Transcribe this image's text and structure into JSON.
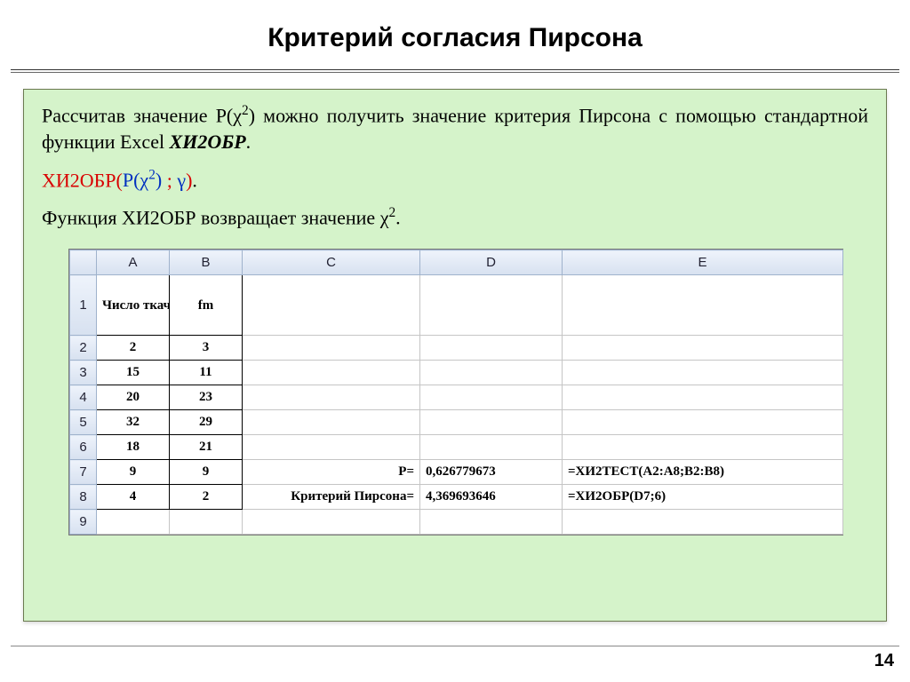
{
  "title": "Критерий согласия Пирсона",
  "para1_a": "Рассчитав значение P(χ",
  "para1_b": ") можно получить значение критерия Пирсона с помощью стандартной функции Excel ",
  "para1_func": "ХИ2ОБР",
  "para1_c": ".",
  "formula": {
    "fn": "ХИ2ОБР(",
    "arg1a": "P(χ",
    "arg1b": ")",
    "sep": " ; ",
    "arg2": "γ",
    "close": ")",
    "dot": "."
  },
  "para2_a": "Функция ХИ2ОБР возвращает значение χ",
  "para2_b": ".",
  "excel": {
    "cols": [
      "",
      "A",
      "B",
      "C",
      "D",
      "E"
    ],
    "header": {
      "a": "Число ткачих, f",
      "b": "fm"
    },
    "rows": [
      {
        "n": "1"
      },
      {
        "n": "2",
        "a": "2",
        "b": "3"
      },
      {
        "n": "3",
        "a": "15",
        "b": "11"
      },
      {
        "n": "4",
        "a": "20",
        "b": "23"
      },
      {
        "n": "5",
        "a": "32",
        "b": "29"
      },
      {
        "n": "6",
        "a": "18",
        "b": "21"
      },
      {
        "n": "7",
        "a": "9",
        "b": "9",
        "c": "P=",
        "d": "0,626779673",
        "e": "=ХИ2ТЕСТ(A2:A8;B2:B8)"
      },
      {
        "n": "8",
        "a": "4",
        "b": "2",
        "c": "Критерий Пирсона=",
        "d": "4,369693646",
        "e": "=ХИ2ОБР(D7;6)"
      },
      {
        "n": "9"
      }
    ]
  },
  "page_number": "14"
}
